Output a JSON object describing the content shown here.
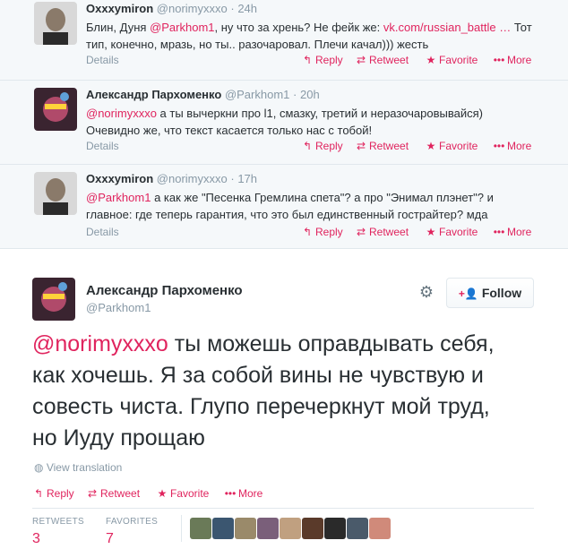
{
  "tweets": [
    {
      "fullname": "Oxxxymiron",
      "username": "@norimyxxxo",
      "dot": "·",
      "time": "24h",
      "text_plain_1": "Блин, Дуня ",
      "mention": "@Parkhom1",
      "text_plain_2": ", ну что за хрень? Не фейк же: ",
      "link": "vk.com/russian_battle …",
      "text_plain_3": " Тот тип, конечно, мразь, но ты.. разочаровал. Плечи качал))) жесть"
    },
    {
      "fullname": "Александр Пархоменко",
      "username": "@Parkhom1",
      "dot": "·",
      "time": "20h",
      "mention": "@norimyxxxo",
      "text_plain_2": " а ты вычеркни про l1, смазку, третий и неразочаровывайся) Очевидно же, что текст касается только нас с тобой!"
    },
    {
      "fullname": "Oxxxymiron",
      "username": "@norimyxxxo",
      "dot": "·",
      "time": "17h",
      "mention": "@Parkhom1",
      "text_plain_2": " а как же \"Песенка Гремлина спета\"? а про \"Энимал плэнет\"? и главное: где теперь гарантия, что это был единственный гострайтер? мда"
    }
  ],
  "actions": {
    "details": "Details",
    "reply": "Reply",
    "retweet": "Retweet",
    "favorite": "Favorite",
    "more": "More",
    "reply_icon": "reply-arrow-icon",
    "retweet_icon": "retweet-icon",
    "favorite_icon": "star-icon",
    "more_icon": "dots-icon"
  },
  "main": {
    "fullname": "Александр Пархоменко",
    "username": "@Parkhom1",
    "follow_label": "Follow",
    "mention": "@norimyxxxo",
    "text": " ты можешь оправдывать себя, как хочешь. Я за собой вины не чувствую и совесть чиста. Глупо перечеркнут мой труд, но Иуду прощаю",
    "view_translation": "View translation",
    "retweets_label": "RETWEETS",
    "retweets_count": "3",
    "favorites_label": "FAVORITES",
    "favorites_count": "7"
  },
  "colors": {
    "accent": "#e0245e",
    "muted": "#8899a6",
    "text": "#292f33",
    "conversation_bg": "#f5f8fa"
  }
}
